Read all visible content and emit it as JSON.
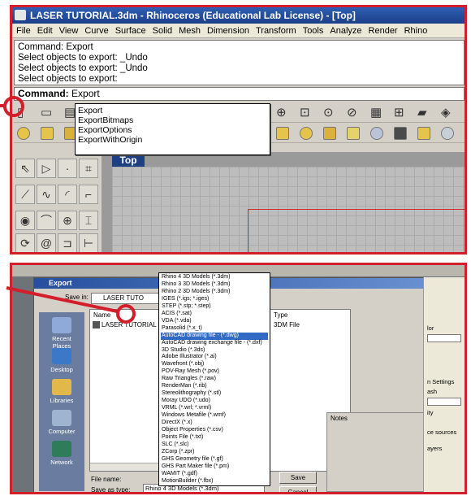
{
  "window": {
    "title": "LASER TUTORIAL.3dm - Rhinoceros (Educational Lab License) - [Top]"
  },
  "menu": [
    "File",
    "Edit",
    "View",
    "Curve",
    "Surface",
    "Solid",
    "Mesh",
    "Dimension",
    "Transform",
    "Tools",
    "Analyze",
    "Render",
    "Rhino"
  ],
  "command_history": [
    "Command: Export",
    "Select objects to export: _Undo",
    "Select objects to export: _Undo",
    "Select objects to export:"
  ],
  "command_prompt": {
    "label": "Command:",
    "value": "Export"
  },
  "autocomplete": [
    "Export",
    "ExportBitmaps",
    "ExportOptions",
    "ExportWithOrigin"
  ],
  "viewport": {
    "label": "Top"
  },
  "colors": {
    "callout": "#d21f2b",
    "title_bar": "#1c3f88",
    "selection": "#316ac5"
  },
  "export_dialog": {
    "title": "Export",
    "save_in_label": "Save in:",
    "save_in_value": "LASER TUTO",
    "columns": {
      "name": "Name",
      "type": "Type"
    },
    "file_row": {
      "name": "LASER TUTORIAL",
      "type": "3DM File"
    },
    "places": [
      "Recent Places",
      "Desktop",
      "Libraries",
      "Computer",
      "Network"
    ],
    "file_types": [
      "Rhino 4 3D Models (*.3dm)",
      "Rhino 3 3D Models (*.3dm)",
      "Rhino 2 3D Models (*.3dm)",
      "IGES (*.igs; *.iges)",
      "STEP (*.stp; *.step)",
      "ACIS (*.sat)",
      "VDA (*.vda)",
      "Parasolid (*.x_t)",
      "AutoCAD drawing file - (*.dwg)",
      "AutoCAD drawing exchange file - (*.dxf)",
      "3D Studio (*.3ds)",
      "Adobe Illustrator (*.ai)",
      "Wavefront (*.obj)",
      "POV-Ray Mesh (*.pov)",
      "Raw Triangles (*.raw)",
      "RenderMan (*.rib)",
      "Stereolithography (*.stl)",
      "Moray UDO (*.udo)",
      "VRML (*.wrl; *.vrml)",
      "Windows Metafile (*.wmf)",
      "DirectX (*.x)",
      "Object Properties (*.csv)",
      "Points File (*.txt)",
      "SLC (*.slc)",
      "ZCorp (*.zpr)",
      "GHS Geometry file (*.gf)",
      "GHS Part Maker file (*.pm)",
      "WAMIT (*.gdf)",
      "MotionBuilder (*.fbx)",
      "XGL (*.xgl)"
    ],
    "selected_index": 8,
    "notes_label": "Notes",
    "file_name_label": "File name:",
    "save_as_type_label": "Save as type:",
    "save_as_type_value": "Rhino 4 3D Models (*.3dm)",
    "save_button": "Save",
    "cancel_button": "Cancel"
  },
  "properties_side": {
    "lines": [
      "lor",
      "n Settings",
      "ash",
      "ity",
      "ce sources",
      "ayers"
    ]
  }
}
